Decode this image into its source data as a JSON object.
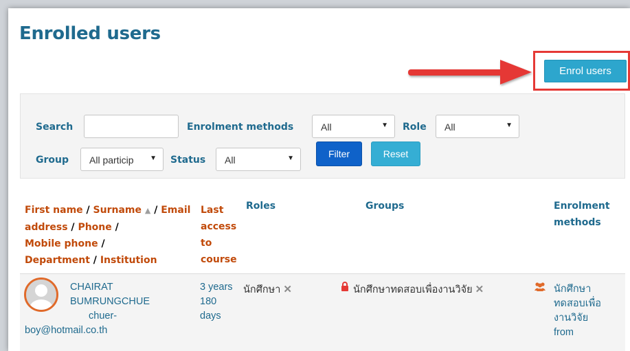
{
  "page": {
    "title": "Enrolled users",
    "enrol_button_label": "Enrol users"
  },
  "filters": {
    "search_label": "Search",
    "search_value": "",
    "enrolment_methods_label": "Enrolment methods",
    "enrolment_methods_value": "All",
    "role_label": "Role",
    "role_value": "All",
    "group_label": "Group",
    "group_value": "All particip",
    "status_label": "Status",
    "status_value": "All",
    "filter_button": "Filter",
    "reset_button": "Reset"
  },
  "table": {
    "headers": {
      "first_name": "First name",
      "surname": "Surname",
      "email": "Email address",
      "phone": "Phone",
      "mobile": "Mobile phone",
      "department": "Department",
      "institution": "Institution",
      "last_access": [
        "Last",
        "access",
        "to",
        "course"
      ],
      "roles": "Roles",
      "groups": "Groups",
      "enrolment_methods": [
        "Enrolment",
        "methods"
      ]
    },
    "rows": [
      {
        "name_line1": "CHAIRAT",
        "name_line2": "BUMRUNGCHUE",
        "email_line1": "chuer-",
        "email_line2": "boy@hotmail.co.th",
        "last_access": [
          "3 years",
          "180",
          "days"
        ],
        "role": "นักศึกษา",
        "group": "นักศึกษาทดสอบเพื่องานวิจัย",
        "enrolment": [
          "นักศึกษา",
          "ทดสอบเพื่อ",
          "งานวิจัย",
          "from"
        ]
      }
    ]
  },
  "icons": {
    "sort": "sort-up-icon",
    "unenrol": "close-icon",
    "lock": "lock-icon",
    "group": "people-icon",
    "arrow": "red-arrow-icon"
  },
  "colors": {
    "heading_blue": "#1f6a8e",
    "link_orange": "#c14a0a",
    "primary_button": "#0f62c9",
    "info_button": "#2da6cd",
    "highlight_red": "#e53935"
  }
}
